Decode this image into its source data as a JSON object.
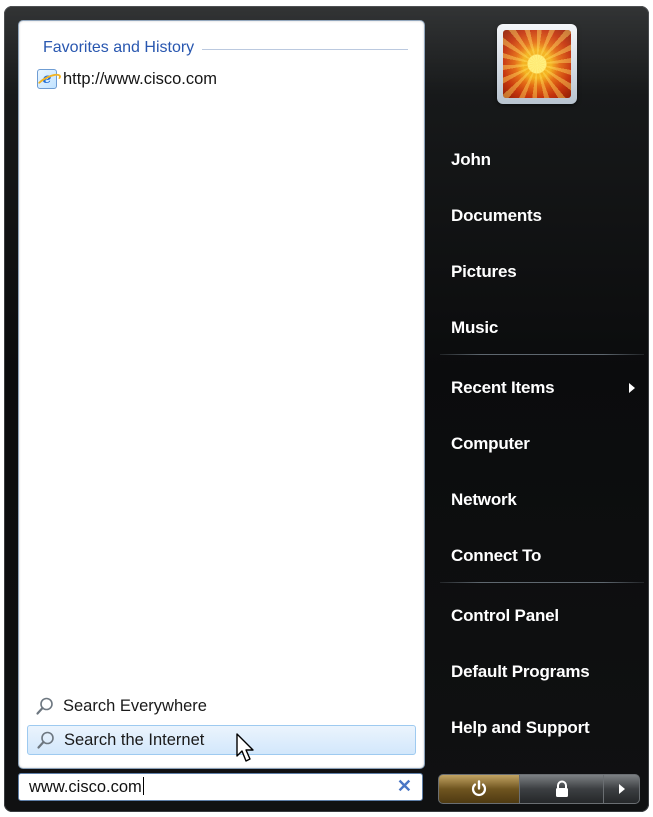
{
  "favorites": {
    "header": "Favorites and History",
    "items": [
      {
        "label": "http://www.cisco.com",
        "icon": "internet-explorer-icon"
      }
    ]
  },
  "search_options": {
    "everywhere": "Search Everywhere",
    "internet": "Search the Internet"
  },
  "search_box": {
    "value": "www.cisco.com",
    "clear_icon": "clear-x-icon"
  },
  "right_menu": {
    "user": "John",
    "items": [
      "Documents",
      "Pictures",
      "Music",
      "Recent Items",
      "Computer",
      "Network",
      "Connect To",
      "Control Panel",
      "Default Programs",
      "Help and Support"
    ]
  },
  "power_bar": {
    "power_icon": "power-icon",
    "lock_icon": "lock-icon",
    "more_icon": "arrow-right-icon"
  },
  "colors": {
    "menu_background": "#0b0c0d",
    "pane_background": "#ffffff",
    "header_text": "#1c4dab",
    "selected_highlight": "#d2e7fb",
    "power_button": "#6f5520"
  }
}
